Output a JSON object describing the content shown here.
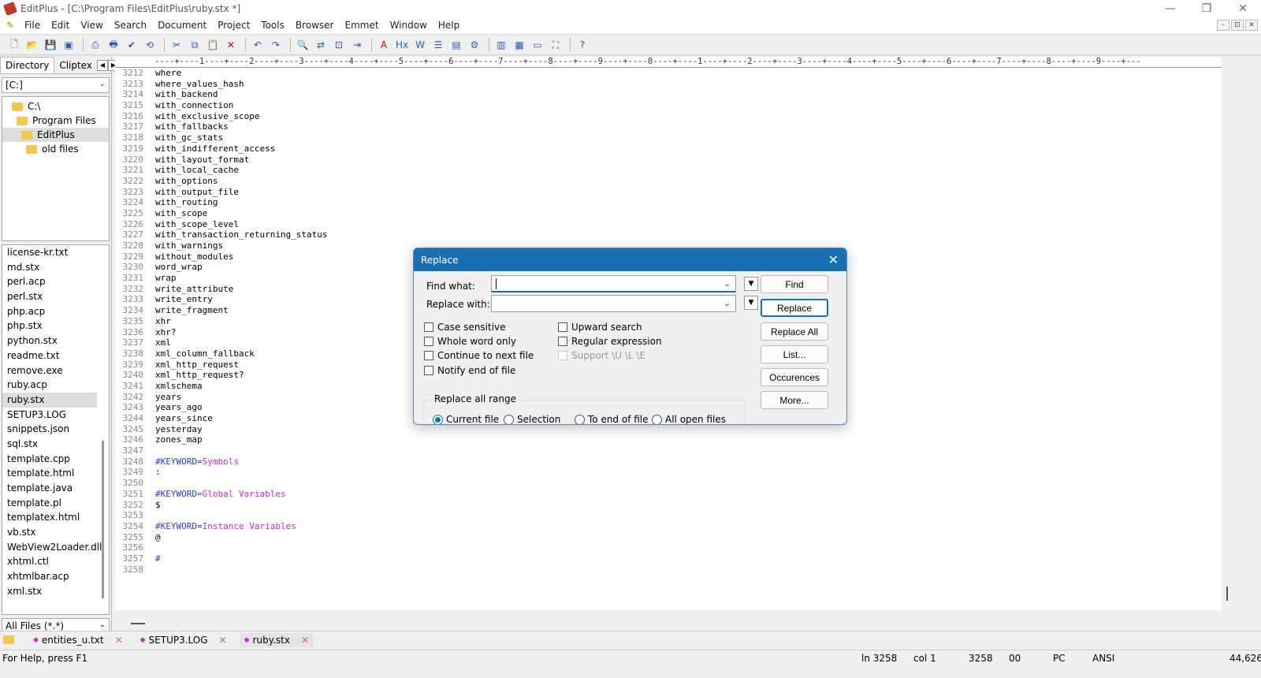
{
  "window": {
    "title": "EditPlus - [C:\\Program Files\\EditPlus\\ruby.stx *]",
    "controls": [
      "—",
      "❐",
      "✕"
    ]
  },
  "menu": [
    "File",
    "Edit",
    "View",
    "Search",
    "Document",
    "Project",
    "Tools",
    "Browser",
    "Emmet",
    "Window",
    "Help"
  ],
  "mdi_controls": [
    "–",
    "⊡",
    "✕"
  ],
  "panel": {
    "tabs": [
      "Directory",
      "Cliptex"
    ],
    "drive": "[C:]",
    "tree": [
      {
        "label": "C:\\",
        "indent": 0
      },
      {
        "label": "Program Files",
        "indent": 1
      },
      {
        "label": "EditPlus",
        "indent": 2,
        "selected": true
      },
      {
        "label": "old files",
        "indent": 2
      }
    ],
    "files": [
      "license-kr.txt",
      "md.stx",
      "perl.acp",
      "perl.stx",
      "php.acp",
      "php.stx",
      "python.stx",
      "readme.txt",
      "remove.exe",
      "ruby.acp",
      "ruby.stx",
      "SETUP3.LOG",
      "snippets.json",
      "sql.stx",
      "template.cpp",
      "template.html",
      "template.java",
      "template.pl",
      "templatex.html",
      "vb.stx",
      "WebView2Loader.dll",
      "xhtml.ctl",
      "xhtmlbar.acp",
      "xml.stx"
    ],
    "selected_file": "ruby.stx",
    "filter": "All Files (*.*)"
  },
  "ruler": "----+----1----+----2----+----3----+----4----+----5----+----6----+----7----+----8----+----9----+----0----+----1----+----2----+----3----+----4----+----5----+----6----+----7----+----8----+----9----+---",
  "editor": {
    "lines": [
      {
        "n": "3212",
        "t": "where"
      },
      {
        "n": "3213",
        "t": "where_values_hash"
      },
      {
        "n": "3214",
        "t": "with_backend"
      },
      {
        "n": "3215",
        "t": "with_connection"
      },
      {
        "n": "3216",
        "t": "with_exclusive_scope"
      },
      {
        "n": "3217",
        "t": "with_fallbacks"
      },
      {
        "n": "3218",
        "t": "with_gc_stats"
      },
      {
        "n": "3219",
        "t": "with_indifferent_access"
      },
      {
        "n": "3220",
        "t": "with_layout_format"
      },
      {
        "n": "3221",
        "t": "with_local_cache"
      },
      {
        "n": "3222",
        "t": "with_options"
      },
      {
        "n": "3223",
        "t": "with_output_file"
      },
      {
        "n": "3224",
        "t": "with_routing"
      },
      {
        "n": "3225",
        "t": "with_scope"
      },
      {
        "n": "3226",
        "t": "with_scope_level"
      },
      {
        "n": "3227",
        "t": "with_transaction_returning_status"
      },
      {
        "n": "3228",
        "t": "with_warnings"
      },
      {
        "n": "3229",
        "t": "without_modules"
      },
      {
        "n": "3230",
        "t": "word_wrap"
      },
      {
        "n": "3231",
        "t": "wrap"
      },
      {
        "n": "3232",
        "t": "write_attribute"
      },
      {
        "n": "3233",
        "t": "write_entry"
      },
      {
        "n": "3234",
        "t": "write_fragment"
      },
      {
        "n": "3235",
        "t": "xhr"
      },
      {
        "n": "3236",
        "t": "xhr?"
      },
      {
        "n": "3237",
        "t": "xml"
      },
      {
        "n": "3238",
        "t": "xml_column_fallback"
      },
      {
        "n": "3239",
        "t": "xml_http_request"
      },
      {
        "n": "3240",
        "t": "xml_http_request?"
      },
      {
        "n": "3241",
        "t": "xmlschema"
      },
      {
        "n": "3242",
        "t": "years"
      },
      {
        "n": "3243",
        "t": "years_ago"
      },
      {
        "n": "3244",
        "t": "years_since"
      },
      {
        "n": "3245",
        "t": "yesterday"
      },
      {
        "n": "3246",
        "t": "zones_map"
      },
      {
        "n": "3247",
        "t": ""
      },
      {
        "n": "3248",
        "t": "#KEYWORD=",
        "k": "Symbols"
      },
      {
        "n": "3249",
        "t": ":"
      },
      {
        "n": "3250",
        "t": ""
      },
      {
        "n": "3251",
        "t": "#KEYWORD=",
        "k": "Global Variables"
      },
      {
        "n": "3252",
        "t": "$"
      },
      {
        "n": "3253",
        "t": ""
      },
      {
        "n": "3254",
        "t": "#KEYWORD=",
        "k": "Instance Variables"
      },
      {
        "n": "3255",
        "t": "@"
      },
      {
        "n": "3256",
        "t": ""
      },
      {
        "n": "3257",
        "t": "#",
        "kwcolor": true
      },
      {
        "n": "3258",
        "t": ""
      }
    ]
  },
  "tabs": [
    {
      "label": "entities_u.txt",
      "active": false
    },
    {
      "label": "SETUP3.LOG",
      "active": false
    },
    {
      "label": "ruby.stx",
      "active": true
    }
  ],
  "status": {
    "help": "For Help, press F1",
    "line": "ln 3258",
    "col": "col 1",
    "total": "3258",
    "code": "00",
    "mode": "PC",
    "encoding": "ANSI",
    "size": "44,626"
  },
  "dialog": {
    "title": "Replace",
    "find_label": "Find what:",
    "find_value": "",
    "replace_label": "Replace with:",
    "replace_value": "",
    "checks_left": [
      "Case sensitive",
      "Whole word only",
      "Continue to next file",
      "Notify end of file"
    ],
    "checks_right": [
      "Upward search",
      "Regular expression",
      "Support \\U \\L \\E"
    ],
    "range_label": "Replace all range",
    "ranges": [
      "Current file",
      "Selection",
      "To end of file",
      "All open files"
    ],
    "range_selected": "Current file",
    "buttons": [
      "Find",
      "Replace",
      "Replace All",
      "List...",
      "Occurences",
      "More..."
    ]
  },
  "colors": {
    "dialog_title_bg": "#1a6fb1",
    "keyword": "#2a3fc9",
    "keyword_name": "#c42ad8"
  }
}
